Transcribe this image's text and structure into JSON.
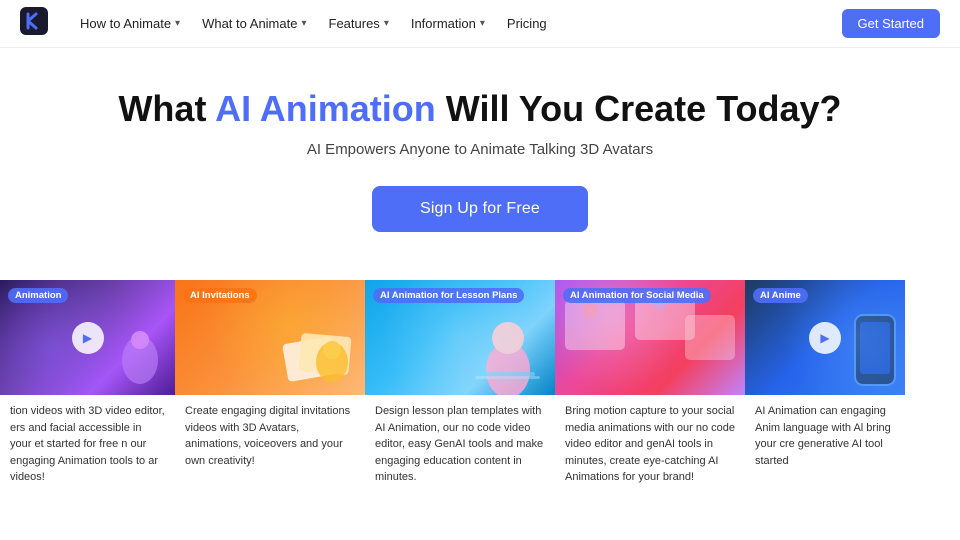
{
  "nav": {
    "logo_text": "K",
    "items": [
      {
        "label": "How to Animate",
        "has_dropdown": true
      },
      {
        "label": "What to Animate",
        "has_dropdown": true
      },
      {
        "label": "Features",
        "has_dropdown": true
      },
      {
        "label": "Information",
        "has_dropdown": true
      },
      {
        "label": "Pricing",
        "has_dropdown": false
      }
    ],
    "cta_label": "Get Started"
  },
  "hero": {
    "title_before": "What ",
    "title_highlight": "AI Animation",
    "title_after": " Will You Create Today?",
    "subtitle": "AI Empowers Anyone to Animate Talking 3D Avatars",
    "cta_label": "Sign Up for Free"
  },
  "cards": [
    {
      "badge": "Animation",
      "badge_color": "blue",
      "description": "tion videos with 3D video editor, ers and facial accessible in your et started for free n our engaging Animation tools to ar videos!",
      "has_play": true
    },
    {
      "badge": "AI Invitations",
      "badge_color": "orange",
      "description": "Create engaging digital invitations videos with 3D Avatars, animations, voiceovers and your own creativity!",
      "has_play": false
    },
    {
      "badge": "AI Animation for Lesson Plans",
      "badge_color": "blue",
      "description": "Design lesson plan templates with AI Animation, our no code video editor, easy GenAI tools and make engaging education content in minutes.",
      "has_play": false
    },
    {
      "badge": "AI Animation for Social Media",
      "badge_color": "blue",
      "description": "Bring motion capture to your social media animations with our no code video editor and genAI tools in minutes, create eye-catching AI Animations for your brand!",
      "has_play": false
    },
    {
      "badge": "AI Anime",
      "badge_color": "blue",
      "description": "AI Animation can engaging Anim language with Al bring your cre generative AI tool started",
      "has_play": true
    }
  ]
}
